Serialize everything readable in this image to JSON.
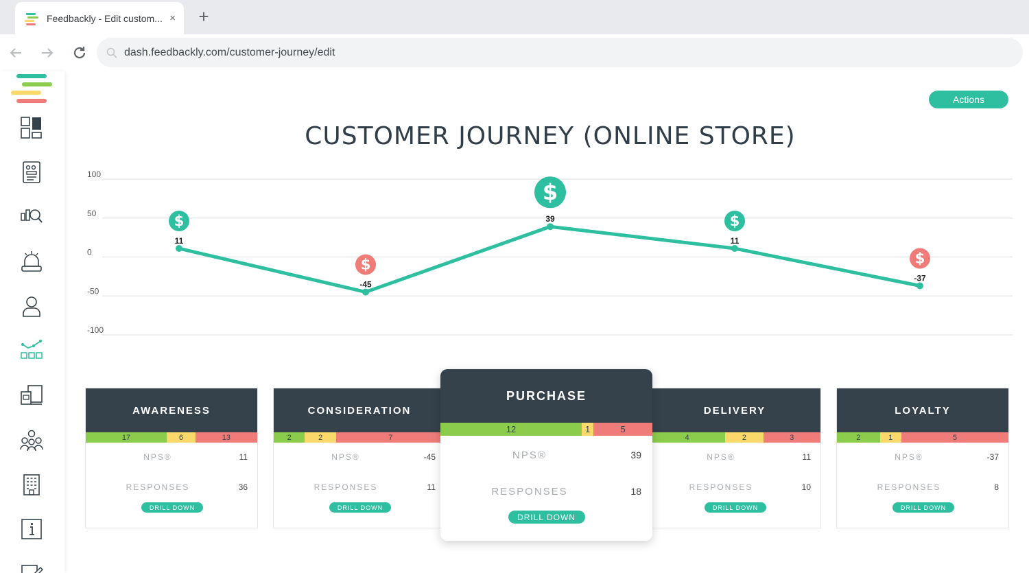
{
  "browser": {
    "tab_title": "Feedbackly - Edit custom...",
    "tab_close": "×",
    "new_tab": "+",
    "url": "dash.feedbackly.com/customer-journey/edit"
  },
  "colors": {
    "accent": "#2dbfa0",
    "positive": "#2dbfa0",
    "negative": "#f07c7a",
    "promoter": "#8ccc4c",
    "passive": "#fad86a",
    "detractor": "#f07c7a",
    "card_header": "#35424b"
  },
  "sidebar": {
    "items": [
      {
        "icon": "dashboard-icon"
      },
      {
        "icon": "survey-icon"
      },
      {
        "icon": "analytics-search-icon"
      },
      {
        "icon": "notifications-bell-icon"
      },
      {
        "icon": "user-icon"
      },
      {
        "icon": "customer-journey-icon",
        "active": true
      },
      {
        "icon": "devices-icon"
      },
      {
        "icon": "team-icon"
      },
      {
        "icon": "organization-building-icon"
      },
      {
        "icon": "info-icon"
      },
      {
        "icon": "edit-icon"
      }
    ]
  },
  "header": {
    "actions_label": "Actions",
    "title": "CUSTOMER JOURNEY (ONLINE STORE)"
  },
  "chart_data": {
    "type": "line",
    "title": "",
    "categories": [
      "AWARENESS",
      "CONSIDERATION",
      "PURCHASE",
      "DELIVERY",
      "LOYALTY"
    ],
    "values": [
      11,
      -45,
      39,
      11,
      -37
    ],
    "y_ticks": [
      100,
      50,
      0,
      -50,
      -100
    ],
    "ylim": [
      -100,
      100
    ],
    "grid": true,
    "markers": [
      "positive",
      "negative",
      "positive",
      "positive",
      "negative"
    ],
    "marker_symbol": "$"
  },
  "cards": {
    "nps_label": "NPS®",
    "responses_label": "RESPONSES",
    "drill_label": "DRILL DOWN",
    "stages": [
      {
        "name": "AWARENESS",
        "promoters": 17,
        "passives": 6,
        "detractors": 13,
        "nps": "11",
        "responses": "36"
      },
      {
        "name": "CONSIDERATION",
        "promoters": 2,
        "passives": 2,
        "detractors": 7,
        "nps": "-45",
        "responses": "11"
      },
      {
        "name": "PURCHASE",
        "promoters": 12,
        "passives": 1,
        "detractors": 5,
        "nps": "39",
        "responses": "18",
        "featured": true
      },
      {
        "name": "DELIVERY",
        "promoters": 4,
        "passives": 2,
        "detractors": 3,
        "nps": "11",
        "responses": "10"
      },
      {
        "name": "LOYALTY",
        "promoters": 2,
        "passives": 1,
        "detractors": 5,
        "nps": "-37",
        "responses": "8"
      }
    ]
  }
}
